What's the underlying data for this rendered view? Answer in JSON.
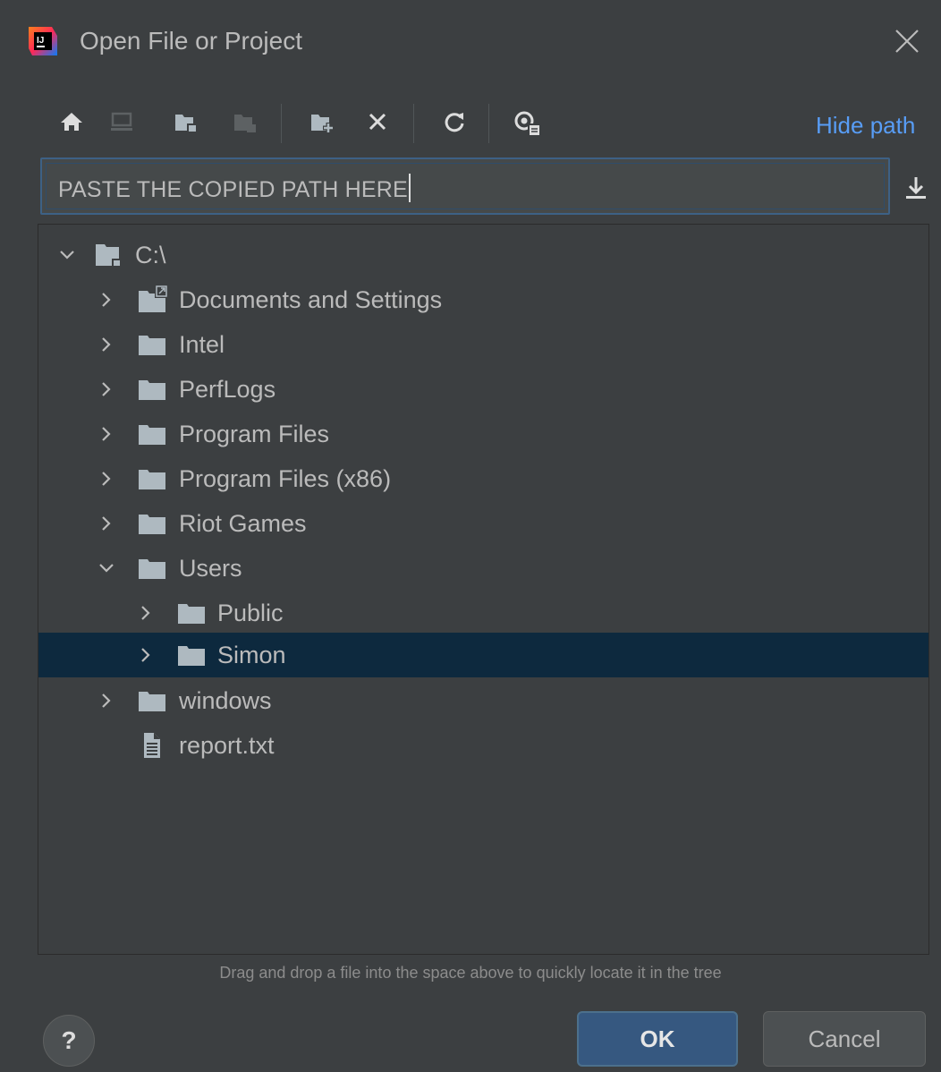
{
  "window": {
    "title": "Open File or Project",
    "app_icon": "intellij-idea-icon",
    "close_icon": "close-icon"
  },
  "toolbar": {
    "icons": [
      "home-icon",
      "desktop-icon",
      "project-folder-icon",
      "module-folder-icon",
      "new-folder-icon",
      "delete-icon",
      "refresh-icon",
      "show-hidden-icon"
    ],
    "hide_path_label": "Hide path"
  },
  "path_field": {
    "value": "PASTE THE COPIED PATH HERE"
  },
  "tree": {
    "items": [
      {
        "label": "C:\\",
        "expanded": true,
        "icon": "drive-icon"
      },
      {
        "label": "Documents and Settings",
        "expanded": false,
        "icon": "symlink-folder-icon"
      },
      {
        "label": "Intel",
        "expanded": false,
        "icon": "folder-icon"
      },
      {
        "label": "PerfLogs",
        "expanded": false,
        "icon": "folder-icon"
      },
      {
        "label": "Program Files",
        "expanded": false,
        "icon": "folder-icon"
      },
      {
        "label": "Program Files (x86)",
        "expanded": false,
        "icon": "folder-icon"
      },
      {
        "label": "Riot Games",
        "expanded": false,
        "icon": "folder-icon"
      },
      {
        "label": "Users",
        "expanded": true,
        "icon": "folder-icon"
      },
      {
        "label": "Public",
        "expanded": false,
        "icon": "folder-icon"
      },
      {
        "label": "Simon",
        "expanded": false,
        "icon": "folder-icon",
        "selected": true
      },
      {
        "label": "windows",
        "expanded": false,
        "icon": "folder-icon"
      },
      {
        "label": "report.txt",
        "icon": "text-file-icon"
      }
    ]
  },
  "hint": "Drag and drop a file into the space above to quickly locate it in the tree",
  "buttons": {
    "help": "?",
    "ok": "OK",
    "cancel": "Cancel"
  },
  "colors": {
    "background": "#3c3f41",
    "selection": "#0d293e",
    "link": "#589df6",
    "primary_button": "#365880"
  }
}
